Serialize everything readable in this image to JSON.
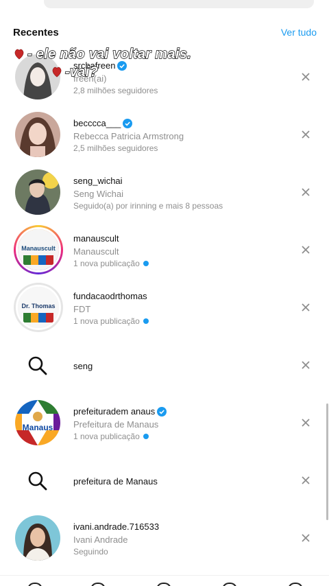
{
  "header": {
    "recents_title": "Recentes",
    "see_all_label": "Ver tudo"
  },
  "overlay": {
    "line1": "- ele não vai voltar mais.",
    "line2": "-vai?"
  },
  "recents": [
    {
      "type": "account",
      "username": "srchafreen",
      "name": "freen(ai)",
      "meta": "2,8 milhões seguidores",
      "verified": true,
      "new_post": false
    },
    {
      "type": "account",
      "username": "becccca___",
      "name": "Rebecca Patricia Armstrong",
      "meta": "2,5 milhões seguidores",
      "verified": true,
      "new_post": false
    },
    {
      "type": "account",
      "username": "seng_wichai",
      "name": "Seng Wichai",
      "meta": "Seguido(a) por irinning e mais 8 pessoas",
      "verified": false,
      "new_post": false
    },
    {
      "type": "account",
      "username": "manauscult",
      "name": "Manauscult",
      "meta": "1 nova publicação",
      "verified": false,
      "new_post": true,
      "avatar_text": "Manauscult"
    },
    {
      "type": "account",
      "username": "fundacaodrthomas",
      "name": "FDT",
      "meta": "1 nova publicação",
      "verified": false,
      "new_post": true,
      "avatar_text": "Dr. Thomas"
    },
    {
      "type": "search",
      "query": "seng"
    },
    {
      "type": "account",
      "username": "prefeituradem anaus",
      "name": "Prefeitura de Manaus",
      "meta": "1 nova publicação",
      "verified": true,
      "new_post": true,
      "avatar_text": "Manaus"
    },
    {
      "type": "search",
      "query": "prefeitura de Manaus"
    },
    {
      "type": "account",
      "username": "ivani.andrade.716533",
      "name": "Ivani Andrade",
      "meta": "Seguindo",
      "verified": false,
      "new_post": false
    }
  ],
  "colors": {
    "accent": "#1a9bf0",
    "secondary_text": "#8e8e8e",
    "primary_text": "#111111"
  },
  "icons": {
    "close": "close-icon",
    "search": "search-icon",
    "verified": "verified-badge-icon"
  }
}
